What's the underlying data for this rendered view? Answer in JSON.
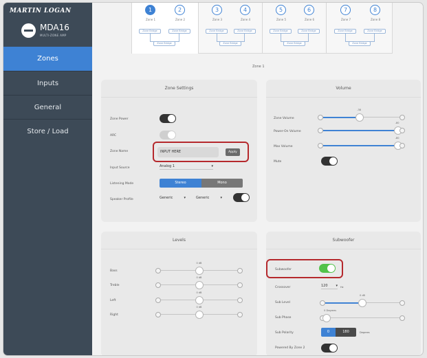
{
  "brand": "MARTIN LOGAN",
  "device": {
    "name": "MDA16",
    "subtitle": "MULTI-ZONE AMP"
  },
  "nav": [
    "Zones",
    "Inputs",
    "General",
    "Store / Load"
  ],
  "zones": [
    {
      "num": "1",
      "label": "Zone 1"
    },
    {
      "num": "2",
      "label": "Zone 2"
    },
    {
      "num": "3",
      "label": "Zone 3"
    },
    {
      "num": "4",
      "label": "Zone 4"
    },
    {
      "num": "5",
      "label": "Zone 5"
    },
    {
      "num": "6",
      "label": "Zone 6"
    },
    {
      "num": "7",
      "label": "Zone 7"
    },
    {
      "num": "8",
      "label": "Zone 8"
    }
  ],
  "zone_bridge_label": "Zone Bridge",
  "current_zone": "Zone 1",
  "zone_settings": {
    "title": "Zone Settings",
    "power_label": "Zone Power",
    "arc_label": "ARC",
    "name_label": "Zone Name",
    "name_value": "INPUT HERE",
    "apply": "Apply",
    "input_source_label": "Input Source",
    "input_source_value": "Analog 1",
    "listening_mode_label": "Listening Mode",
    "mode_stereo": "Stereo",
    "mode_mono": "Mono",
    "speaker_profile_label": "Speaker Profile",
    "profile_left": "Generic",
    "profile_right": "Generic"
  },
  "volume": {
    "title": "Volume",
    "zone_volume_label": "Zone Volume",
    "zone_volume_value": "-38",
    "zone_volume_level": 0.48,
    "power_on_volume_label": "Power-On Volume",
    "power_on_volume_value": "-80",
    "power_on_volume_level": 0.98,
    "max_volume_label": "Max Volume",
    "max_volume_value": "-80",
    "max_volume_level": 0.98,
    "mute_label": "Mute"
  },
  "levels": {
    "title": "Levels",
    "bass_label": "Bass",
    "bass_value": "0 dB",
    "treble_label": "Treble",
    "treble_value": "0 dB",
    "left_label": "Left",
    "left_value": "0 dB",
    "right_label": "Right",
    "right_value": "0 dB"
  },
  "subwoofer": {
    "title": "Subwoofer",
    "sub_label": "Subwoofer",
    "crossover_label": "Crossover",
    "crossover_value": "120",
    "crossover_unit": "Hz",
    "sub_level_label": "Sub Level",
    "sub_level_value": "0 dB",
    "sub_level_level": 0.5,
    "sub_phase_label": "Sub Phase",
    "sub_phase_value": "0 Degrees",
    "sub_phase_level": 0.02,
    "sub_polarity_label": "Sub Polarity",
    "polarity_0": "0",
    "polarity_180": "180",
    "polarity_unit": "Degrees",
    "powered_by_label": "Powered By Zone 2"
  },
  "colors": {
    "sidebar": "#3d4a57",
    "accent": "#3e82d4",
    "highlight": "#b5282c",
    "toggle_on": "#52c24a"
  }
}
